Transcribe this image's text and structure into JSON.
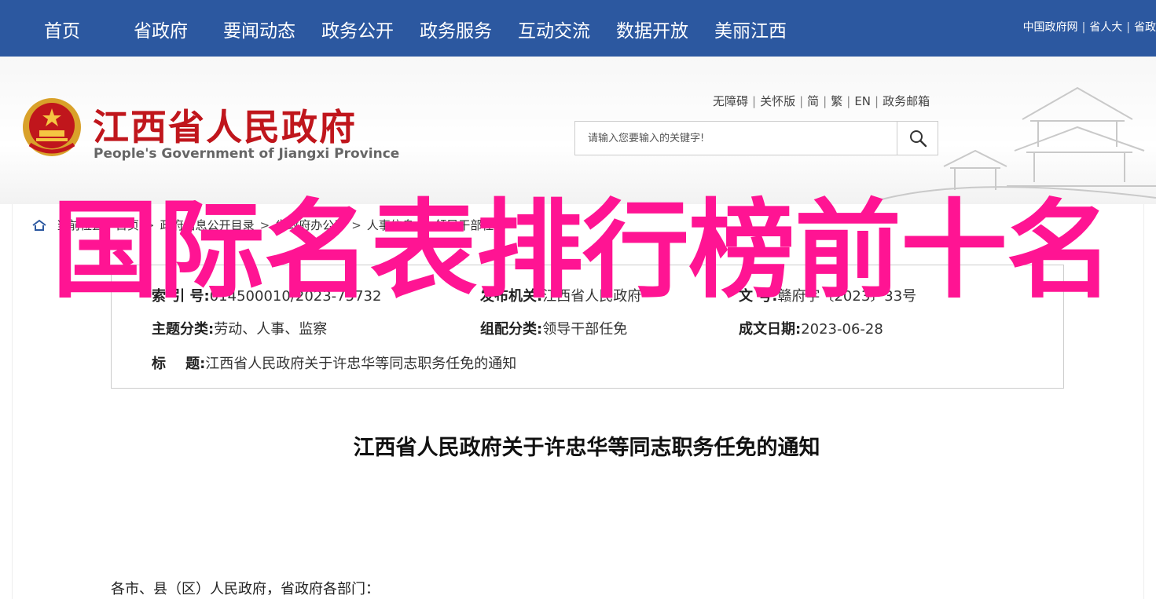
{
  "nav": {
    "items": [
      "首页",
      "省政府",
      "要闻动态",
      "政务公开",
      "政务服务",
      "互动交流",
      "数据开放",
      "美丽江西"
    ],
    "right_links": [
      "中国政府网",
      "省人大",
      "省政"
    ]
  },
  "header": {
    "title": "江西省人民政府",
    "subtitle": "People's Government of Jiangxi Province",
    "util_links": [
      "无障碍",
      "关怀版",
      "简",
      "繁",
      "EN",
      "政务邮箱"
    ],
    "search_placeholder": "请输入您要输入的关键字!"
  },
  "breadcrumb": {
    "label": "当前位置：",
    "items": [
      "首页",
      "政府信息公开目录",
      "省政府办公厅",
      "人事信息",
      "领导干部任免"
    ]
  },
  "meta": {
    "index_label": "索 引 号:",
    "index_value": "014500010/2023-75732",
    "issuer_label": "发布机关:",
    "issuer_value": "江西省人民政府",
    "docno_label": "文 号:",
    "docno_value": "赣府字〔2023〕33号",
    "topic_label": "主题分类:",
    "topic_value": "劳动、人事、监察",
    "category_label": "组配分类:",
    "category_value": "领导干部任免",
    "date_label": "成文日期:",
    "date_value": "2023-06-28",
    "title_label": "标    题:",
    "title_value": "江西省人民政府关于许忠华等同志职务任免的通知"
  },
  "document": {
    "title": "江西省人民政府关于许忠华等同志职务任免的通知",
    "salutation": "各市、县（区）人民政府，省政府各部门："
  },
  "overlay_text": "国际名表排行榜前十名",
  "colors": {
    "nav_bg": "#2c58a0",
    "brand_red": "#c0161c",
    "overlay": "#ff1493"
  }
}
